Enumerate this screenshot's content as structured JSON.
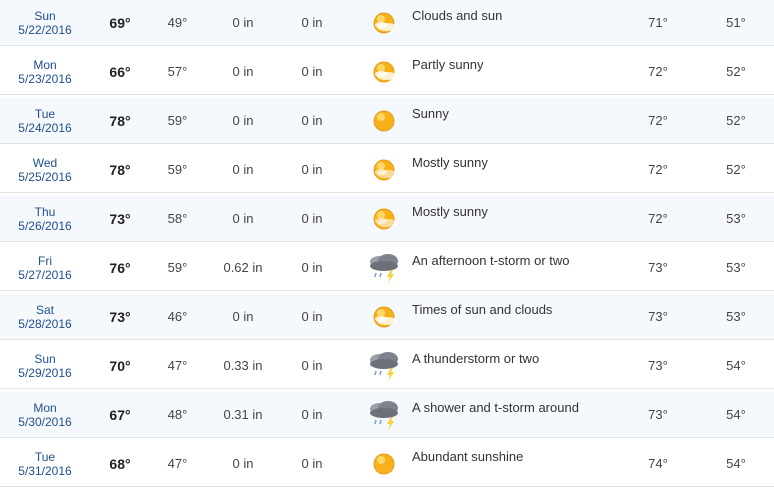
{
  "rows": [
    {
      "dow": "Sun",
      "date": "5/22/2016",
      "hi": "69°",
      "lo": "49°",
      "precip": "0 in",
      "snow": "0 in",
      "icon": "clouds-and-sun-icon",
      "desc": "Clouds and sun",
      "norm_hi": "71°",
      "norm_lo": "51°"
    },
    {
      "dow": "Mon",
      "date": "5/23/2016",
      "hi": "66°",
      "lo": "57°",
      "precip": "0 in",
      "snow": "0 in",
      "icon": "partly-sunny-icon",
      "desc": "Partly sunny",
      "norm_hi": "72°",
      "norm_lo": "52°"
    },
    {
      "dow": "Tue",
      "date": "5/24/2016",
      "hi": "78°",
      "lo": "59°",
      "precip": "0 in",
      "snow": "0 in",
      "icon": "sunny-icon",
      "desc": "Sunny",
      "norm_hi": "72°",
      "norm_lo": "52°"
    },
    {
      "dow": "Wed",
      "date": "5/25/2016",
      "hi": "78°",
      "lo": "59°",
      "precip": "0 in",
      "snow": "0 in",
      "icon": "mostly-sunny-icon",
      "desc": "Mostly sunny",
      "norm_hi": "72°",
      "norm_lo": "52°"
    },
    {
      "dow": "Thu",
      "date": "5/26/2016",
      "hi": "73°",
      "lo": "58°",
      "precip": "0 in",
      "snow": "0 in",
      "icon": "mostly-sunny-icon",
      "desc": "Mostly sunny",
      "norm_hi": "72°",
      "norm_lo": "53°"
    },
    {
      "dow": "Fri",
      "date": "5/27/2016",
      "hi": "76°",
      "lo": "59°",
      "precip": "0.62 in",
      "snow": "0 in",
      "icon": "thunderstorm-icon",
      "desc": "An afternoon t-storm or two",
      "norm_hi": "73°",
      "norm_lo": "53°"
    },
    {
      "dow": "Sat",
      "date": "5/28/2016",
      "hi": "73°",
      "lo": "46°",
      "precip": "0 in",
      "snow": "0 in",
      "icon": "sun-and-clouds-icon",
      "desc": "Times of sun and clouds",
      "norm_hi": "73°",
      "norm_lo": "53°"
    },
    {
      "dow": "Sun",
      "date": "5/29/2016",
      "hi": "70°",
      "lo": "47°",
      "precip": "0.33 in",
      "snow": "0 in",
      "icon": "thunderstorm-icon",
      "desc": "A thunderstorm or two",
      "norm_hi": "73°",
      "norm_lo": "54°"
    },
    {
      "dow": "Mon",
      "date": "5/30/2016",
      "hi": "67°",
      "lo": "48°",
      "precip": "0.31 in",
      "snow": "0 in",
      "icon": "thunderstorm-icon",
      "desc": "A shower and t-storm around",
      "norm_hi": "73°",
      "norm_lo": "54°"
    },
    {
      "dow": "Tue",
      "date": "5/31/2016",
      "hi": "68°",
      "lo": "47°",
      "precip": "0 in",
      "snow": "0 in",
      "icon": "sunny-icon",
      "desc": "Abundant sunshine",
      "norm_hi": "74°",
      "norm_lo": "54°"
    }
  ],
  "colors": {
    "date_text": "#1f4f8f",
    "row_alt": "#f5f8fc",
    "sun": "#f7b21b",
    "cloud": "#8a8f98"
  }
}
